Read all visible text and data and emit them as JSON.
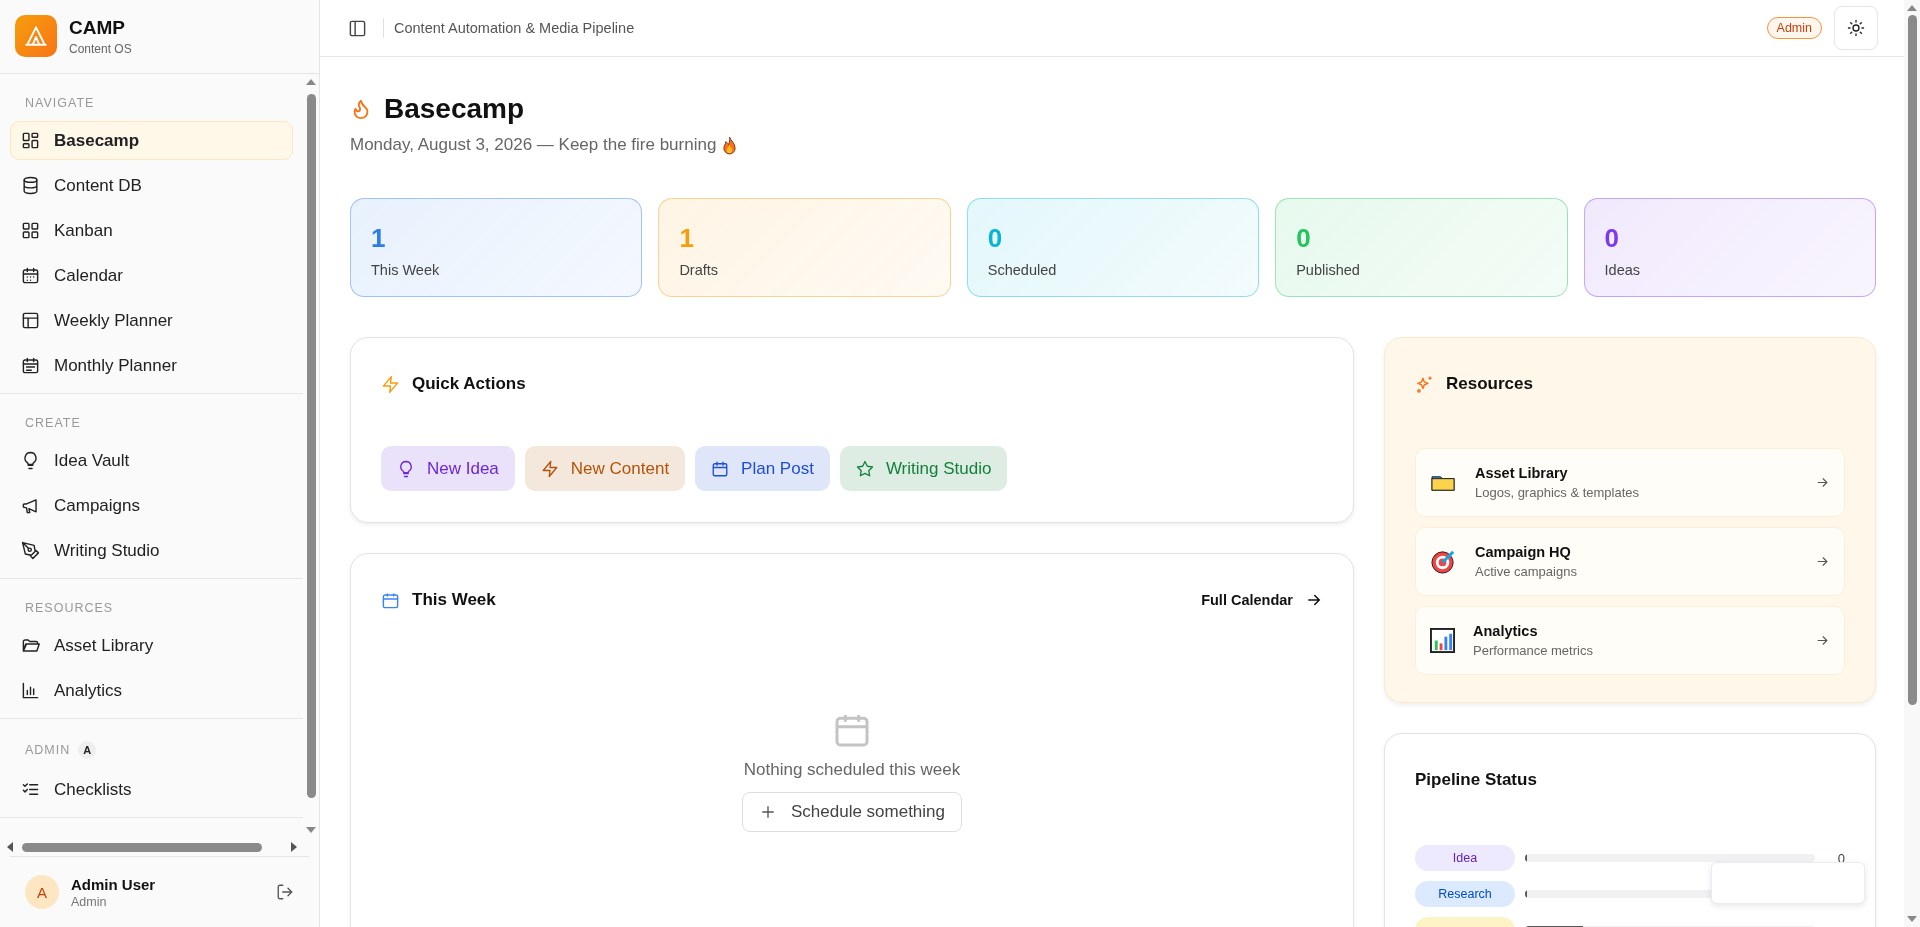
{
  "brand": {
    "name": "CAMP",
    "tagline": "Content OS"
  },
  "sidebar": {
    "sections": [
      {
        "title": "NAVIGATE",
        "items": [
          {
            "label": "Basecamp",
            "selected": true
          },
          {
            "label": "Content DB",
            "selected": false
          },
          {
            "label": "Kanban",
            "selected": false
          },
          {
            "label": "Calendar",
            "selected": false
          },
          {
            "label": "Weekly Planner",
            "selected": false
          },
          {
            "label": "Monthly Planner",
            "selected": false
          }
        ]
      },
      {
        "title": "CREATE",
        "items": [
          {
            "label": "Idea Vault",
            "selected": false
          },
          {
            "label": "Campaigns",
            "selected": false
          },
          {
            "label": "Writing Studio",
            "selected": false
          }
        ]
      },
      {
        "title": "RESOURCES",
        "items": [
          {
            "label": "Asset Library",
            "selected": false
          },
          {
            "label": "Analytics",
            "selected": false
          }
        ]
      },
      {
        "title": "ADMIN",
        "badge": "A",
        "items": [
          {
            "label": "Checklists",
            "selected": false
          }
        ]
      }
    ],
    "user": {
      "initial": "A",
      "name": "Admin User",
      "role": "Admin"
    }
  },
  "header": {
    "title": "Content Automation & Media Pipeline",
    "badge": "Admin"
  },
  "page": {
    "title": "Basecamp",
    "subtitle": "Monday, August 3, 2026 — Keep the fire burning"
  },
  "stats": [
    {
      "value": "1",
      "label": "This Week",
      "color": "#2b7de9"
    },
    {
      "value": "1",
      "label": "Drafts",
      "color": "#f59e0b"
    },
    {
      "value": "0",
      "label": "Scheduled",
      "color": "#06b6d4"
    },
    {
      "value": "0",
      "label": "Published",
      "color": "#22c55e"
    },
    {
      "value": "0",
      "label": "Ideas",
      "color": "#7c3aed"
    }
  ],
  "quick_actions": {
    "title": "Quick Actions",
    "buttons": [
      {
        "label": "New Idea",
        "color": "#6d28d9"
      },
      {
        "label": "New Content",
        "color": "#b45309"
      },
      {
        "label": "Plan Post",
        "color": "#1d4ed8"
      },
      {
        "label": "Writing Studio",
        "color": "#15803d"
      }
    ]
  },
  "this_week": {
    "title": "This Week",
    "link": "Full Calendar",
    "empty": "Nothing scheduled this week",
    "action": "Schedule something"
  },
  "resources": {
    "title": "Resources",
    "items": [
      {
        "title": "Asset Library",
        "subtitle": "Logos, graphics & templates"
      },
      {
        "title": "Campaign HQ",
        "subtitle": "Active campaigns"
      },
      {
        "title": "Analytics",
        "subtitle": "Performance metrics"
      }
    ]
  },
  "pipeline": {
    "title": "Pipeline Status",
    "rows": [
      {
        "label": "Idea",
        "count": "0",
        "level": 0,
        "color": "#ede9fe"
      },
      {
        "label": "Research",
        "level": 0,
        "color": "#dbeafe"
      },
      {
        "level": 0.2,
        "color": "#fef3c7"
      }
    ]
  }
}
